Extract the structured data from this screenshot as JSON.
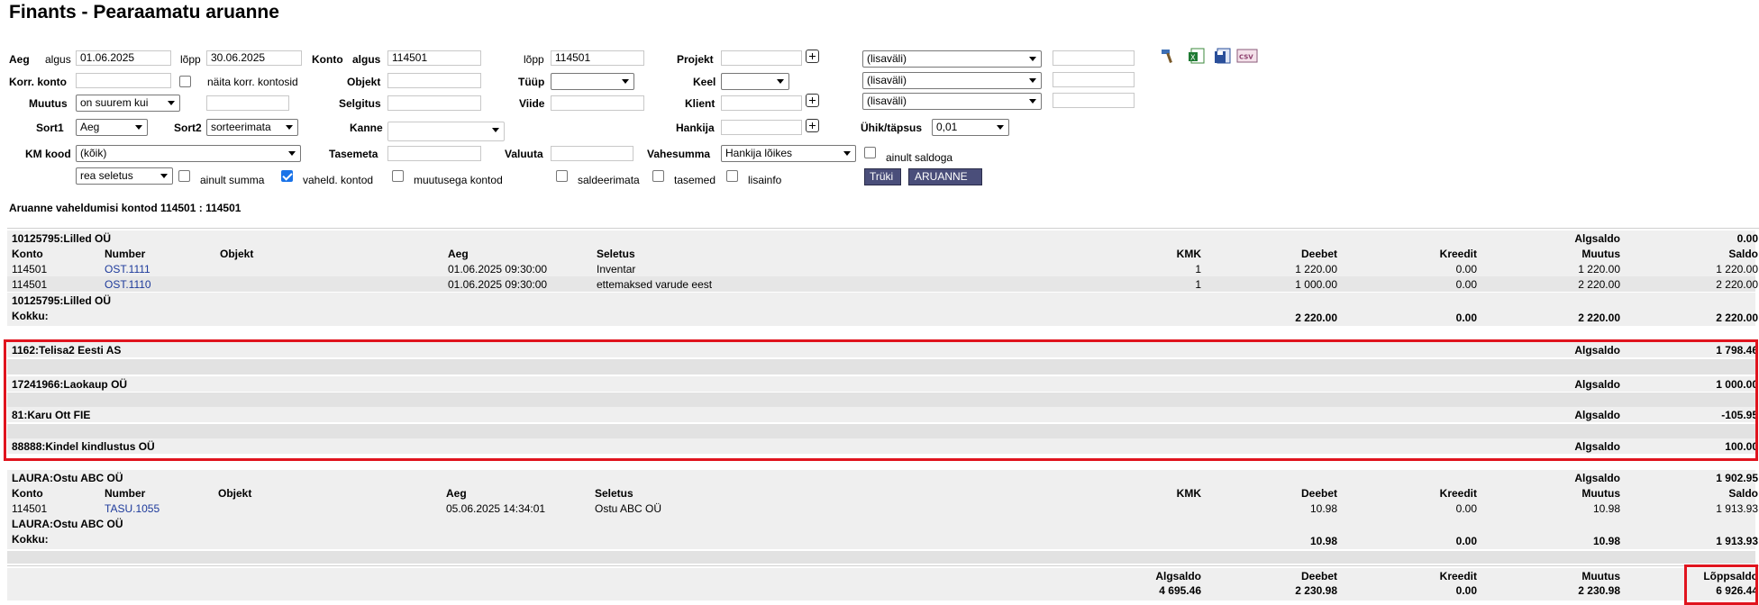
{
  "title": "Finants - Pearaamatu aruanne",
  "filters": {
    "aeg_label": "Aeg",
    "algus_label": "algus",
    "algus_value": "01.06.2025",
    "lopp_label": "lõpp",
    "lopp_value": "30.06.2025",
    "konto_label": "Konto",
    "konto_algus_label": "algus",
    "konto_algus_value": "114501",
    "konto_lopp_label": "lõpp",
    "konto_lopp_value": "114501",
    "projekt_label": "Projekt",
    "projekt_value": "",
    "dd1": "(lisaväli)",
    "dd2": "(lisaväli)",
    "dd3": "(lisaväli)",
    "korr_konto_label": "Korr. konto",
    "korr_konto_value": "",
    "naita_korr_label": "näita korr. kontosid",
    "objekt_label": "Objekt",
    "tyyp_label": "Tüüp",
    "tyyp_value": "",
    "keel_label": "Keel",
    "keel_value": "",
    "muutus_label": "Muutus",
    "muutus_value": "on suurem kui",
    "muutus_amount": "",
    "selgitus_label": "Selgitus",
    "viide_label": "Viide",
    "klient_label": "Klient",
    "sort1_label": "Sort1",
    "sort1_value": "Aeg",
    "sort2_label": "Sort2",
    "sort2_value": "sorteerimata",
    "kanne_label": "Kanne",
    "kanne_value": "",
    "hankija_label": "Hankija",
    "yhik_label": "Ühik/täpsus",
    "yhik_value": "0,01",
    "km_kood_label": "KM kood",
    "km_kood_value": "(kõik)",
    "tasemeta_label": "Tasemeta",
    "valuuta_label": "Valuuta",
    "vahesumma_label": "Vahesumma",
    "vahesumma_value": "Hankija lõikes",
    "ainult_saldoga_label": "ainult saldoga",
    "rea_seletus_value": "rea seletus",
    "ainult_summa_label": "ainult summa",
    "vaheld_kontod_label": "vaheld. kontod",
    "muutusega_kontod_label": "muutusega kontod",
    "saldeerimata_label": "saldeerimata",
    "tasemed_label": "tasemed",
    "lisainfo_label": "lisainfo",
    "truki_label": "Trüki",
    "aruanne_label": "ARUANNE"
  },
  "report_subtitle": "Aruanne vaheldumisi kontod 114501 : 114501",
  "headers": {
    "konto": "Konto",
    "number": "Number",
    "objekt": "Objekt",
    "aeg": "Aeg",
    "seletus": "Seletus",
    "kmk": "KMK",
    "deebet": "Deebet",
    "kreedit": "Kreedit",
    "muutus": "Muutus",
    "saldo": "Saldo",
    "algsaldo": "Algsaldo",
    "kokku": "Kokku:",
    "loppsaldo": "Lõppsaldo"
  },
  "group1": {
    "name": "10125795:Lilled OÜ",
    "algsaldo": "0.00",
    "rows": [
      {
        "konto": "114501",
        "number": "OST.1111",
        "aeg": "01.06.2025 09:30:00",
        "seletus": "Inventar",
        "kmk": "1",
        "deebet": "1 220.00",
        "kreedit": "0.00",
        "muutus": "1 220.00",
        "saldo": "1 220.00"
      },
      {
        "konto": "114501",
        "number": "OST.1110",
        "aeg": "01.06.2025 09:30:00",
        "seletus": "ettemaksed varude eest",
        "kmk": "1",
        "deebet": "1 000.00",
        "kreedit": "0.00",
        "muutus": "2 220.00",
        "saldo": "2 220.00"
      }
    ],
    "total": {
      "deebet": "2 220.00",
      "kreedit": "0.00",
      "muutus": "2 220.00",
      "saldo": "2 220.00"
    }
  },
  "suppliers": [
    {
      "name": "1162:Telisa2 Eesti AS",
      "algsaldo": "1 798.46"
    },
    {
      "name": "17241966:Laokaup OÜ",
      "algsaldo": "1 000.00"
    },
    {
      "name": "81:Karu Ott FIE",
      "algsaldo": "-105.95"
    },
    {
      "name": "88888:Kindel kindlustus OÜ",
      "algsaldo": "100.00"
    }
  ],
  "group2": {
    "name": "LAURA:Ostu ABC OÜ",
    "algsaldo": "1 902.95",
    "rows": [
      {
        "konto": "114501",
        "number": "TASU.1055",
        "aeg": "05.06.2025 14:34:01",
        "seletus": "Ostu ABC OÜ",
        "kmk": "",
        "deebet": "10.98",
        "kreedit": "0.00",
        "muutus": "10.98",
        "saldo": "1 913.93"
      }
    ],
    "total": {
      "deebet": "10.98",
      "kreedit": "0.00",
      "muutus": "10.98",
      "saldo": "1 913.93"
    }
  },
  "grand_total": {
    "algsaldo": "4 695.46",
    "deebet": "2 230.98",
    "kreedit": "0.00",
    "muutus": "2 230.98",
    "loppsaldo": "6 926.44"
  },
  "colors": {
    "highlight_border": "#e0141e",
    "link": "#1d3a9b",
    "button": "#4a4e7a",
    "row_shade": "#efefef"
  }
}
